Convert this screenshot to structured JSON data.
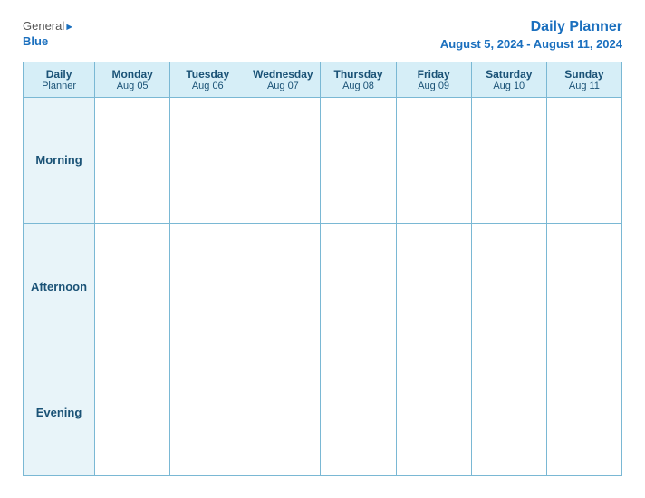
{
  "header": {
    "logo": {
      "general": "General",
      "blue": "Blue",
      "icon": "▶"
    },
    "title": "Daily Planner",
    "date_range": "August 5, 2024 - August 11, 2024"
  },
  "table": {
    "header_label": {
      "line1": "Daily",
      "line2": "Planner"
    },
    "days": [
      {
        "name": "Monday",
        "date": "Aug 05"
      },
      {
        "name": "Tuesday",
        "date": "Aug 06"
      },
      {
        "name": "Wednesday",
        "date": "Aug 07"
      },
      {
        "name": "Thursday",
        "date": "Aug 08"
      },
      {
        "name": "Friday",
        "date": "Aug 09"
      },
      {
        "name": "Saturday",
        "date": "Aug 10"
      },
      {
        "name": "Sunday",
        "date": "Aug 11"
      }
    ],
    "rows": [
      {
        "label": "Morning"
      },
      {
        "label": "Afternoon"
      },
      {
        "label": "Evening"
      }
    ]
  }
}
